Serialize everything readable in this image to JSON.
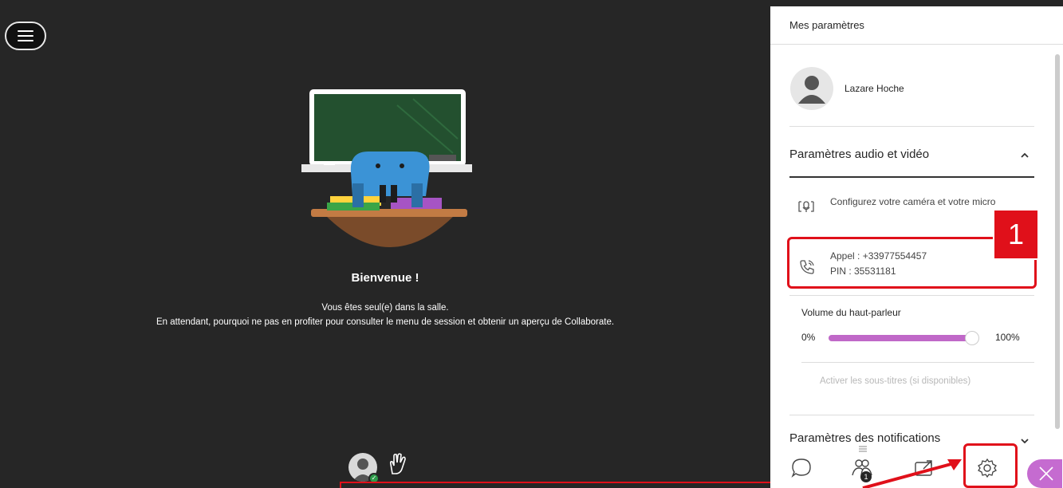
{
  "stage": {
    "welcome_title": "Bienvenue !",
    "welcome_line1": "Vous êtes seul(e) dans la salle.",
    "welcome_line2": "En attendant, pourquoi ne pas en profiter pour consulter le menu de session et obtenir un aperçu de Collaborate."
  },
  "panel": {
    "title": "Mes paramètres",
    "user_name": "Lazare Hoche",
    "audio_video_title": "Paramètres audio et vidéo",
    "camera_config": "Configurez votre caméra et votre micro",
    "call_number": "Appel : +33977554457",
    "call_pin": "PIN : 35531181",
    "volume_label": "Volume du haut-parleur",
    "volume_min": "0%",
    "volume_max": "100%",
    "volume_value": 0.95,
    "subtitles_toggle": "Activer les sous-titres (si disponibles)",
    "notifications_title": "Paramètres des notifications"
  },
  "toolbar": {
    "people_count": "1"
  },
  "annotation": {
    "step_number": "1"
  },
  "colors": {
    "accent": "#c56bd0",
    "annotation_red": "#e0101a",
    "stage_bg": "#262626"
  }
}
